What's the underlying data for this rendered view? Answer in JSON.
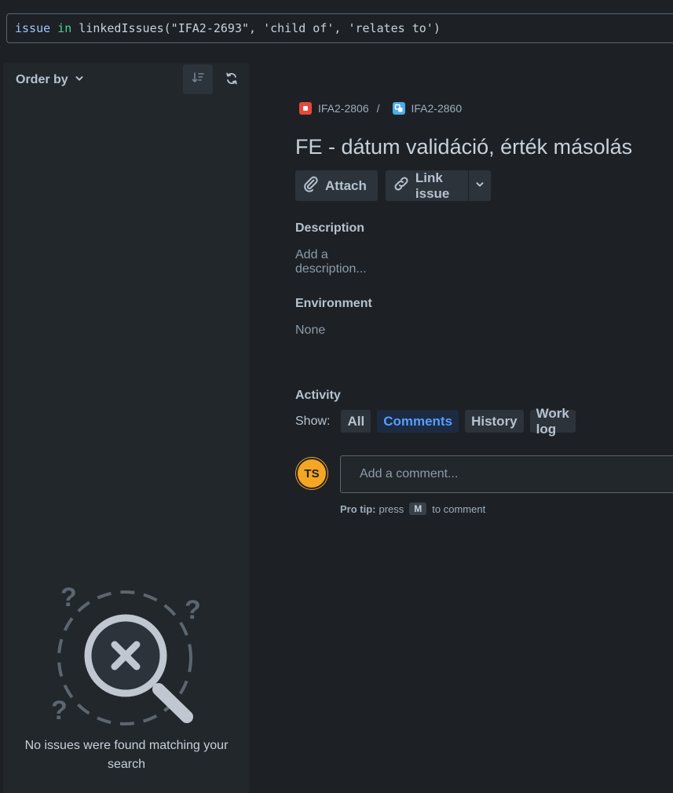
{
  "jql": {
    "tokens": [
      {
        "text": "issue",
        "kind": "field"
      },
      {
        "text": " ",
        "kind": "ws"
      },
      {
        "text": "in",
        "kind": "kw"
      },
      {
        "text": " linkedIssues(\"IFA2-2693\", 'child of', 'relates to')",
        "kind": "fn"
      }
    ]
  },
  "left_panel": {
    "order_by_label": "Order by",
    "empty_message": "No issues were found matching your search"
  },
  "breadcrumb": {
    "parent_key": "IFA2-2806",
    "separator": "/",
    "issue_key": "IFA2-2860",
    "parent_icon_color": "#e5493a",
    "issue_icon_color": "#4bade8"
  },
  "issue": {
    "title": "FE - dátum validáció, érték másolás"
  },
  "actions": {
    "attach_label": "Attach",
    "link_issue_label": "Link issue"
  },
  "description": {
    "label": "Description",
    "placeholder": "Add a description..."
  },
  "environment": {
    "label": "Environment",
    "value": "None"
  },
  "activity": {
    "label": "Activity",
    "show_label": "Show:",
    "filters": [
      {
        "label": "All",
        "active": false
      },
      {
        "label": "Comments",
        "active": true
      },
      {
        "label": "History",
        "active": false
      },
      {
        "label": "Work log",
        "active": false
      }
    ]
  },
  "comment": {
    "avatar_initials": "TS",
    "avatar_color": "#f5a623",
    "placeholder": "Add a comment...",
    "pro_tip_prefix": "Pro tip:",
    "pro_tip_press": "press",
    "pro_tip_key": "M",
    "pro_tip_suffix": "to comment"
  }
}
